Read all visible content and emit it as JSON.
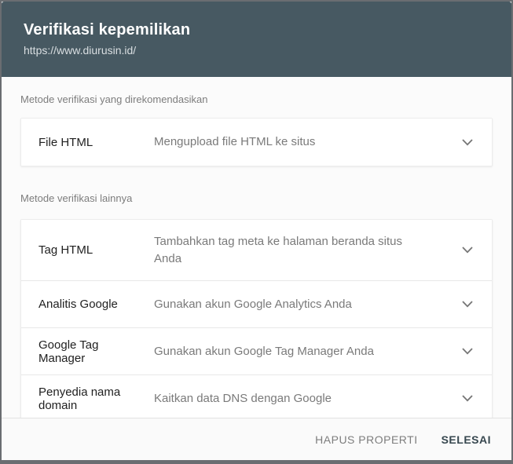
{
  "header": {
    "title": "Verifikasi kepemilikan",
    "subtitle": "https://www.diurusin.id/"
  },
  "sections": [
    {
      "label": "Metode verifikasi yang direkomendasikan",
      "methods": [
        {
          "name": "File HTML",
          "description": "Mengupload file HTML ke situs"
        }
      ]
    },
    {
      "label": "Metode verifikasi lainnya",
      "methods": [
        {
          "name": "Tag HTML",
          "description": "Tambahkan tag meta ke halaman beranda situs Anda"
        },
        {
          "name": "Analitis Google",
          "description": "Gunakan akun Google Analytics Anda"
        },
        {
          "name": "Google Tag Manager",
          "description": "Gunakan akun Google Tag Manager Anda"
        },
        {
          "name": "Penyedia nama domain",
          "description": "Kaitkan data DNS dengan Google"
        }
      ]
    }
  ],
  "footer": {
    "remove_label": "HAPUS PROPERTI",
    "done_label": "SELESAI"
  },
  "icons": {
    "row_expander": "chevron-down-icon"
  },
  "colors": {
    "header_bg": "#475962",
    "body_bg": "#fbfbfb",
    "footer_bg": "#fafafa",
    "subtitle_text": "#d9dee1",
    "muted_text": "#7d7d7d",
    "desc_text": "#7a7a7a",
    "primary_action": "#37474f"
  }
}
